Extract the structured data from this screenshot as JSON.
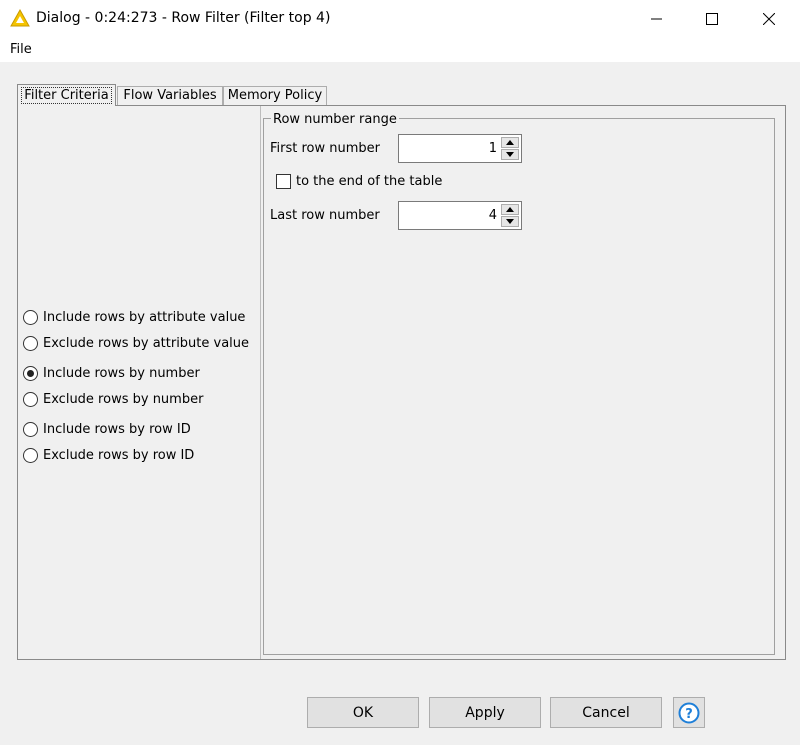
{
  "window": {
    "title": "Dialog - 0:24:273 - Row Filter (Filter top 4)",
    "icon": "warning-triangle-icon",
    "accent_color": "#f5c400"
  },
  "menu": {
    "file": "File"
  },
  "tabs": [
    {
      "label": "Filter Criteria",
      "active": true
    },
    {
      "label": "Flow Variables",
      "active": false
    },
    {
      "label": "Memory Policy",
      "active": false
    }
  ],
  "filter_options": [
    {
      "label": "Include rows by attribute value",
      "selected": false
    },
    {
      "label": "Exclude rows by attribute value",
      "selected": false
    },
    {
      "label": "Include rows by number",
      "selected": true
    },
    {
      "label": "Exclude rows by number",
      "selected": false
    },
    {
      "label": "Include rows by row ID",
      "selected": false
    },
    {
      "label": "Exclude rows by row ID",
      "selected": false
    }
  ],
  "row_range": {
    "legend": "Row number range",
    "first_label": "First row number",
    "first_value": "1",
    "to_end_label": "to the end of the table",
    "to_end_checked": false,
    "last_label": "Last row number",
    "last_value": "4"
  },
  "buttons": {
    "ok": "OK",
    "apply": "Apply",
    "cancel": "Cancel",
    "help_icon": "help-icon",
    "help_color": "#1e7fd8"
  }
}
